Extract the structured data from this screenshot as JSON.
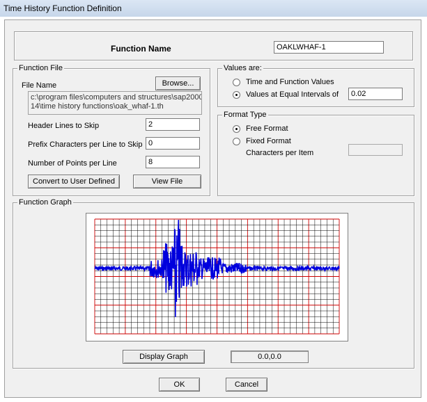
{
  "window": {
    "title": "Time History  Function Definition"
  },
  "function_name": {
    "label": "Function Name",
    "value": "OAKLWHAF-1"
  },
  "function_file": {
    "group_title": "Function File",
    "file_name_label": "File Name",
    "browse_label": "Browse...",
    "path_lines": [
      "c:\\program files\\computers and structures\\sap2000",
      "14\\time history functions\\oak_whaf-1.th"
    ],
    "header_lines_label": "Header Lines to Skip",
    "header_lines_value": "2",
    "prefix_chars_label": "Prefix Characters per Line to Skip",
    "prefix_chars_value": "0",
    "points_per_line_label": "Number of Points per Line",
    "points_per_line_value": "8",
    "convert_label": "Convert to User Defined",
    "view_file_label": "View File"
  },
  "values_are": {
    "group_title": "Values are:",
    "option_time_function": "Time and Function Values",
    "option_equal_intervals": "Values at Equal Intervals of",
    "selected": "equal_intervals",
    "interval_value": "0.02"
  },
  "format_type": {
    "group_title": "Format Type",
    "option_free": "Free Format",
    "option_fixed": "Fixed Format",
    "chars_per_item_label": "Characters per Item",
    "selected": "free",
    "chars_per_item_value": ""
  },
  "function_graph": {
    "group_title": "Function Graph",
    "display_graph_label": "Display Graph",
    "coordinate_readout": "0.0,0.0",
    "colors": {
      "grid_minor": "#000000",
      "grid_major": "#cc0000",
      "trace": "#0000dd"
    }
  },
  "footer": {
    "ok_label": "OK",
    "cancel_label": "Cancel"
  }
}
